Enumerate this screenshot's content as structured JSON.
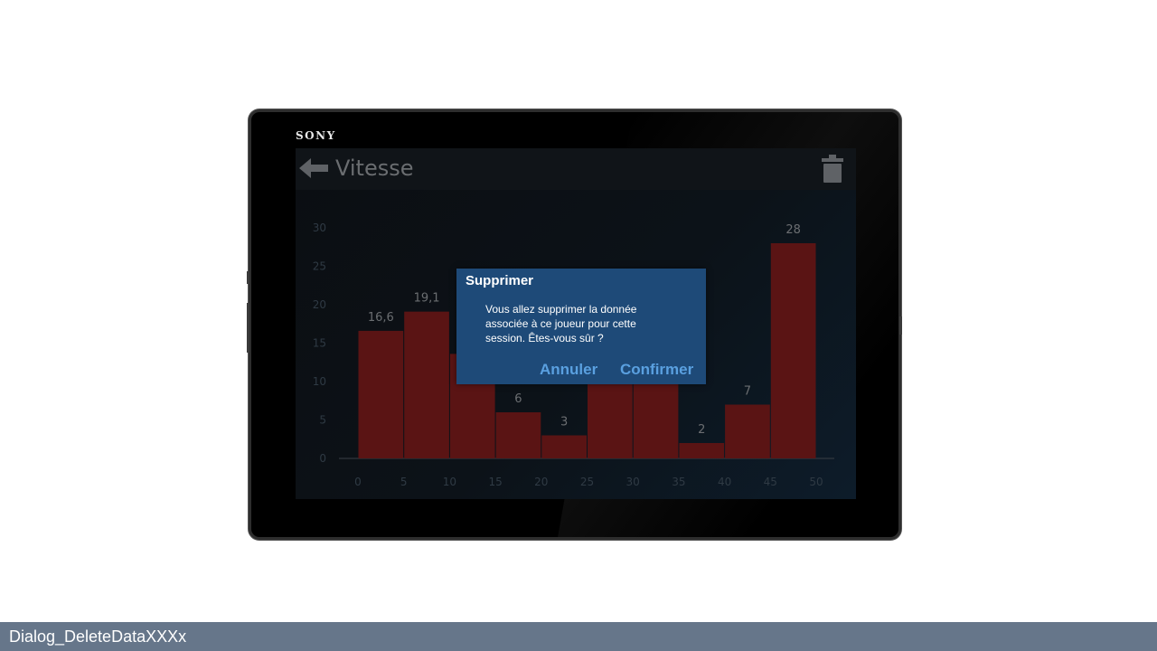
{
  "device": {
    "brand": "SONY"
  },
  "app": {
    "title": "Vitesse",
    "back_icon": "arrow-left-icon",
    "delete_icon": "trash-icon"
  },
  "chart_data": {
    "type": "bar",
    "xlabel": "",
    "ylabel": "",
    "x_ticks": [
      "0",
      "5",
      "10",
      "15",
      "20",
      "25",
      "30",
      "35",
      "40",
      "45",
      "50"
    ],
    "y_ticks": [
      "0",
      "5",
      "10",
      "15",
      "20",
      "25",
      "30"
    ],
    "ylim": [
      0,
      30
    ],
    "bar_color": "#5a1414",
    "bins": [
      {
        "from": 0,
        "to": 5,
        "value": 16.6,
        "label": "16,6"
      },
      {
        "from": 5,
        "to": 10,
        "value": 19.1,
        "label": "19,1"
      },
      {
        "from": 10,
        "to": 15,
        "value": 13.6,
        "label": ""
      },
      {
        "from": 15,
        "to": 20,
        "value": 6,
        "label": "6"
      },
      {
        "from": 20,
        "to": 25,
        "value": 3,
        "label": "3"
      },
      {
        "from": 25,
        "to": 30,
        "value": 10,
        "label": ""
      },
      {
        "from": 30,
        "to": 35,
        "value": 10,
        "label": ""
      },
      {
        "from": 35,
        "to": 40,
        "value": 2,
        "label": "2"
      },
      {
        "from": 40,
        "to": 45,
        "value": 7,
        "label": "7"
      },
      {
        "from": 45,
        "to": 50,
        "value": 28,
        "label": "28"
      }
    ]
  },
  "dialog": {
    "title": "Supprimer",
    "message": "Vous allez supprimer  la donnée associée à ce joueur pour  cette session. Êtes-vous sûr ?",
    "cancel_label": "Annuler",
    "confirm_label": "Confirmer",
    "background": "#1e4a78",
    "button_color": "#5aa0e0"
  },
  "caption": "Dialog_DeleteDataXXXx"
}
